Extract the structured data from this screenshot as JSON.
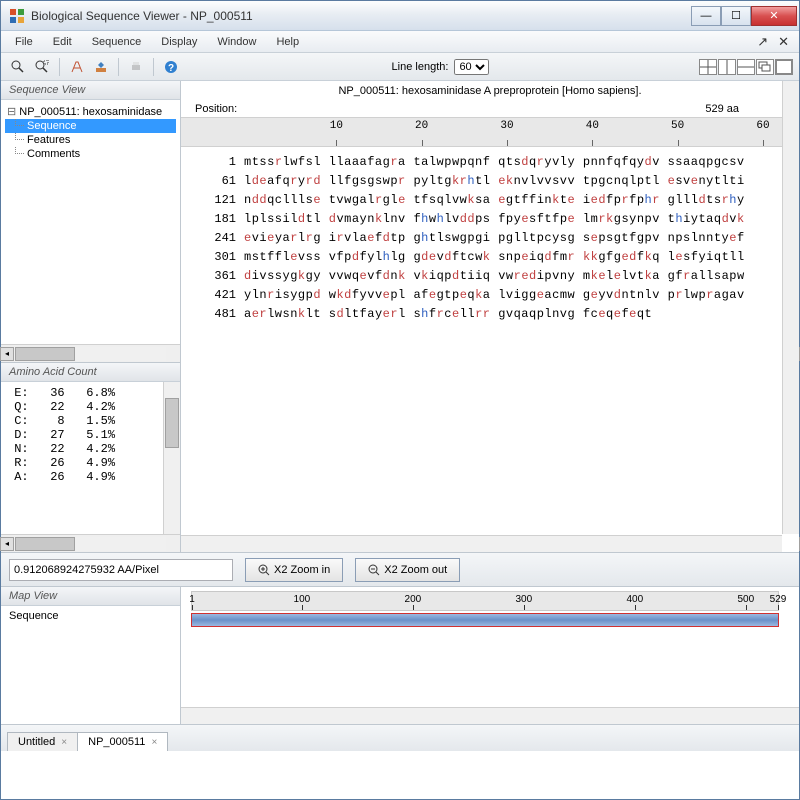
{
  "window": {
    "title": "Biological Sequence Viewer - NP_000511"
  },
  "menus": [
    "File",
    "Edit",
    "Sequence",
    "Display",
    "Window",
    "Help"
  ],
  "toolbar": {
    "line_length_label": "Line length:",
    "line_length_value": "60"
  },
  "sequence_view": {
    "header": "Sequence View",
    "root": "NP_000511: hexosaminidase",
    "children": [
      "Sequence",
      "Features",
      "Comments"
    ],
    "selected_index": 0
  },
  "amino_acid_count": {
    "header": "Amino Acid Count",
    "rows": [
      {
        "aa": "A",
        "count": 26,
        "pct": "4.9%"
      },
      {
        "aa": "R",
        "count": 26,
        "pct": "4.9%"
      },
      {
        "aa": "N",
        "count": 22,
        "pct": "4.2%"
      },
      {
        "aa": "D",
        "count": 27,
        "pct": "5.1%"
      },
      {
        "aa": "C",
        "count": 8,
        "pct": "1.5%"
      },
      {
        "aa": "Q",
        "count": 22,
        "pct": "4.2%"
      },
      {
        "aa": "E",
        "count": 36,
        "pct": "6.8%"
      }
    ]
  },
  "sequence_panel": {
    "title": "NP_000511: hexosaminidase A preproprotein [Homo sapiens].",
    "position_label": "Position:",
    "length_label": "529 aa",
    "ruler_ticks": [
      10,
      20,
      30,
      40,
      50,
      60
    ],
    "rows": [
      {
        "n": 1,
        "blocks": [
          "mtssrlwfsl",
          "llaaafagra",
          "talwpwpqnf",
          "qtsdqryvly",
          "pnnfqfqydv",
          "ssaaqpgcsv"
        ]
      },
      {
        "n": 61,
        "blocks": [
          "ldeafqryrd",
          "llfgsgswpr",
          "pyltgkrhtl",
          "eknvlvvsvv",
          "tpgcnqlptl",
          "esvenytlti"
        ]
      },
      {
        "n": 121,
        "blocks": [
          "nddqclllse",
          "tvwgalrgle",
          "tfsqlvwksa",
          "egtffinkte",
          "iedfprfphr",
          "gllldtsrhy"
        ]
      },
      {
        "n": 181,
        "blocks": [
          "lplssildtl",
          "dvmaynklnv",
          "fhwhlvddps",
          "fpyesftfpe",
          "lmrkgsynpv",
          "thiytaqdvk"
        ]
      },
      {
        "n": 241,
        "blocks": [
          "evieyarlrg",
          "irvlaefdtp",
          "ghtlswgpgi",
          "pglltpcysg",
          "sepsgtfgpv",
          "npslnntyef"
        ]
      },
      {
        "n": 301,
        "blocks": [
          "mstfflevss",
          "vfpdfylhlg",
          "gdevdftcwk",
          "snpeiqdfmr",
          "kkgfgedfkq",
          "lesfyiqtll"
        ]
      },
      {
        "n": 361,
        "blocks": [
          "divssygkgy",
          "vvwqevfdnk",
          "vkiqpdtiiq",
          "vwredipvny",
          "mkelelvtka",
          "gfrallsapw"
        ]
      },
      {
        "n": 421,
        "blocks": [
          "ylnrisygpd",
          "wkdfyvvepl",
          "afegtpeqka",
          "lviggeacmw",
          "geyvdntnlv",
          "prlwpragav"
        ]
      },
      {
        "n": 481,
        "blocks": [
          "aerlwsnklt",
          "sdltfayerl",
          "shfrcellrr",
          "gvqaqplnvg",
          "fceqefeqt",
          ""
        ]
      }
    ]
  },
  "zoom": {
    "ratio": "0.912068924275932 AA/Pixel",
    "zoom_in_label": "X2 Zoom in",
    "zoom_out_label": "X2 Zoom out"
  },
  "map_view": {
    "header": "Map View",
    "track_label": "Sequence",
    "ticks": [
      1,
      100,
      200,
      300,
      400,
      500,
      529
    ]
  },
  "tabs": [
    {
      "label": "Untitled",
      "active": false
    },
    {
      "label": "NP_000511",
      "active": true
    }
  ],
  "colors": {
    "red_residues": "dehknqrst",
    "blue_residues": "bcfgilmpvwy"
  }
}
